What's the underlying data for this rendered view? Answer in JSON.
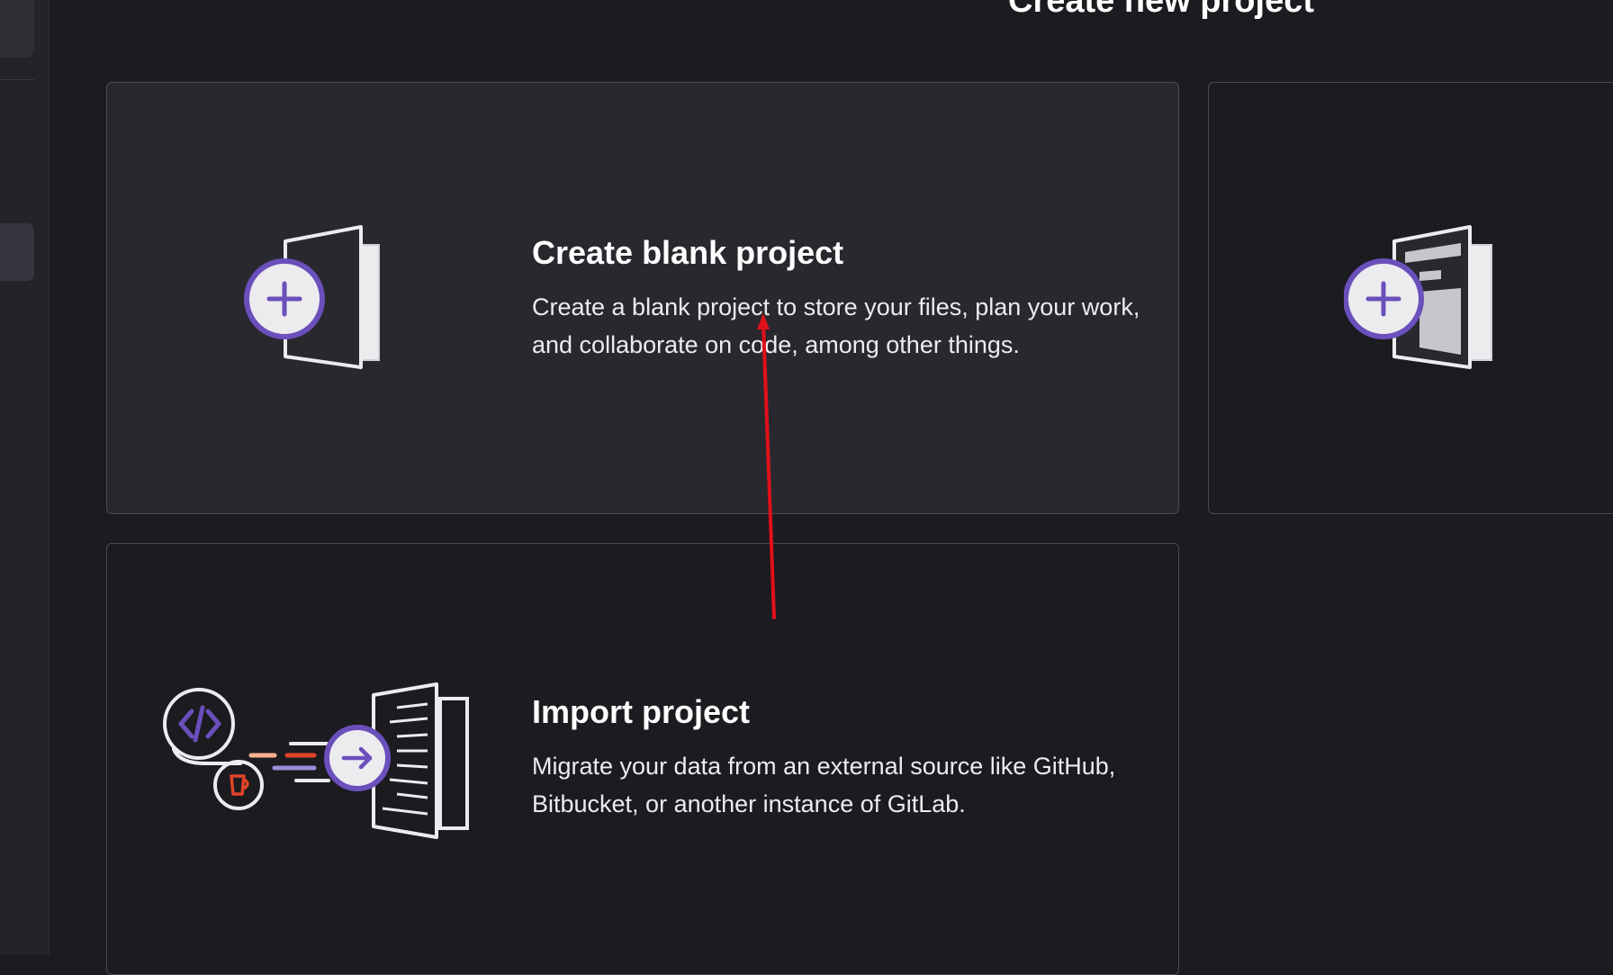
{
  "header": {
    "title": "Create new project"
  },
  "cards": {
    "blank": {
      "title": "Create blank project",
      "description": "Create a blank project to store your files, plan your work, and collaborate on code, among other things."
    },
    "import": {
      "title": "Import project",
      "description": "Migrate your data from an external source like GitHub, Bitbucket, or another instance of GitLab."
    }
  },
  "icons": {
    "blank_illustration": "plus-document-icon",
    "template_illustration": "plus-template-document-icon",
    "import_illustration": "import-code-document-icon"
  },
  "colors": {
    "accent_purple": "#6b4fbb",
    "accent_orange": "#e24329",
    "annotation_red": "#e0101a"
  }
}
